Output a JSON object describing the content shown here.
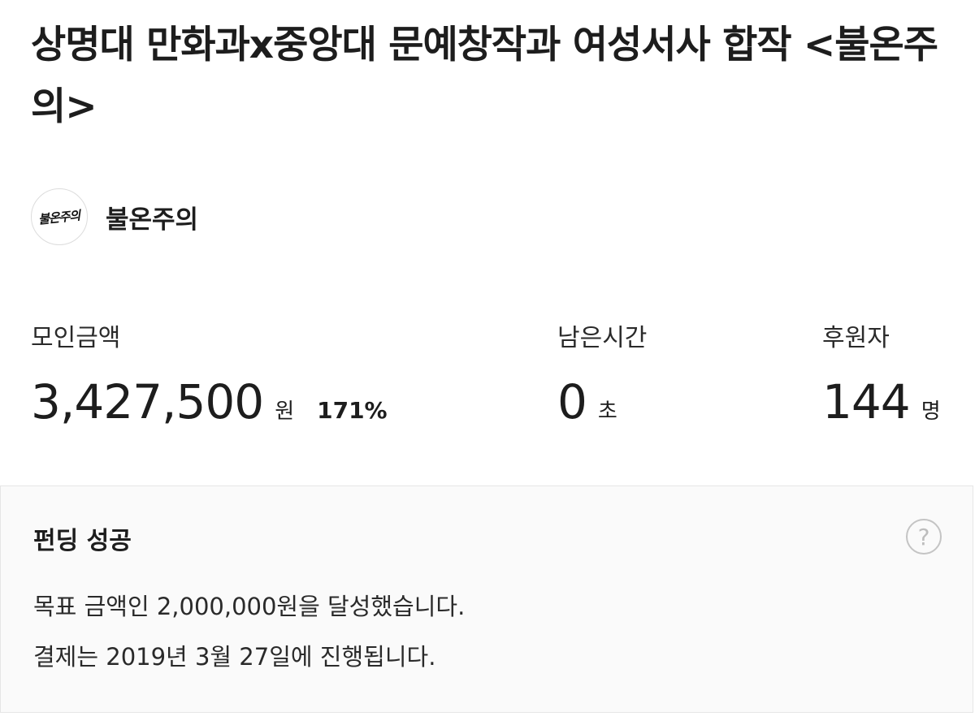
{
  "project": {
    "title": "상명대 만화과x중앙대 문예창작과 여성서사 합작 <불온주의>"
  },
  "creator": {
    "avatar_text": "불온주의",
    "name": "불온주의"
  },
  "stats": {
    "amount": {
      "label": "모인금액",
      "value": "3,427,500",
      "unit": "원",
      "percent": "171%"
    },
    "time_left": {
      "label": "남은시간",
      "value": "0",
      "unit": "초"
    },
    "backers": {
      "label": "후원자",
      "value": "144",
      "unit": "명"
    }
  },
  "status": {
    "title": "펀딩 성공",
    "help_icon": "?",
    "line1": "목표 금액인 2,000,000원을 달성했습니다.",
    "line2": "결제는 2019년 3월 27일에 진행됩니다."
  }
}
